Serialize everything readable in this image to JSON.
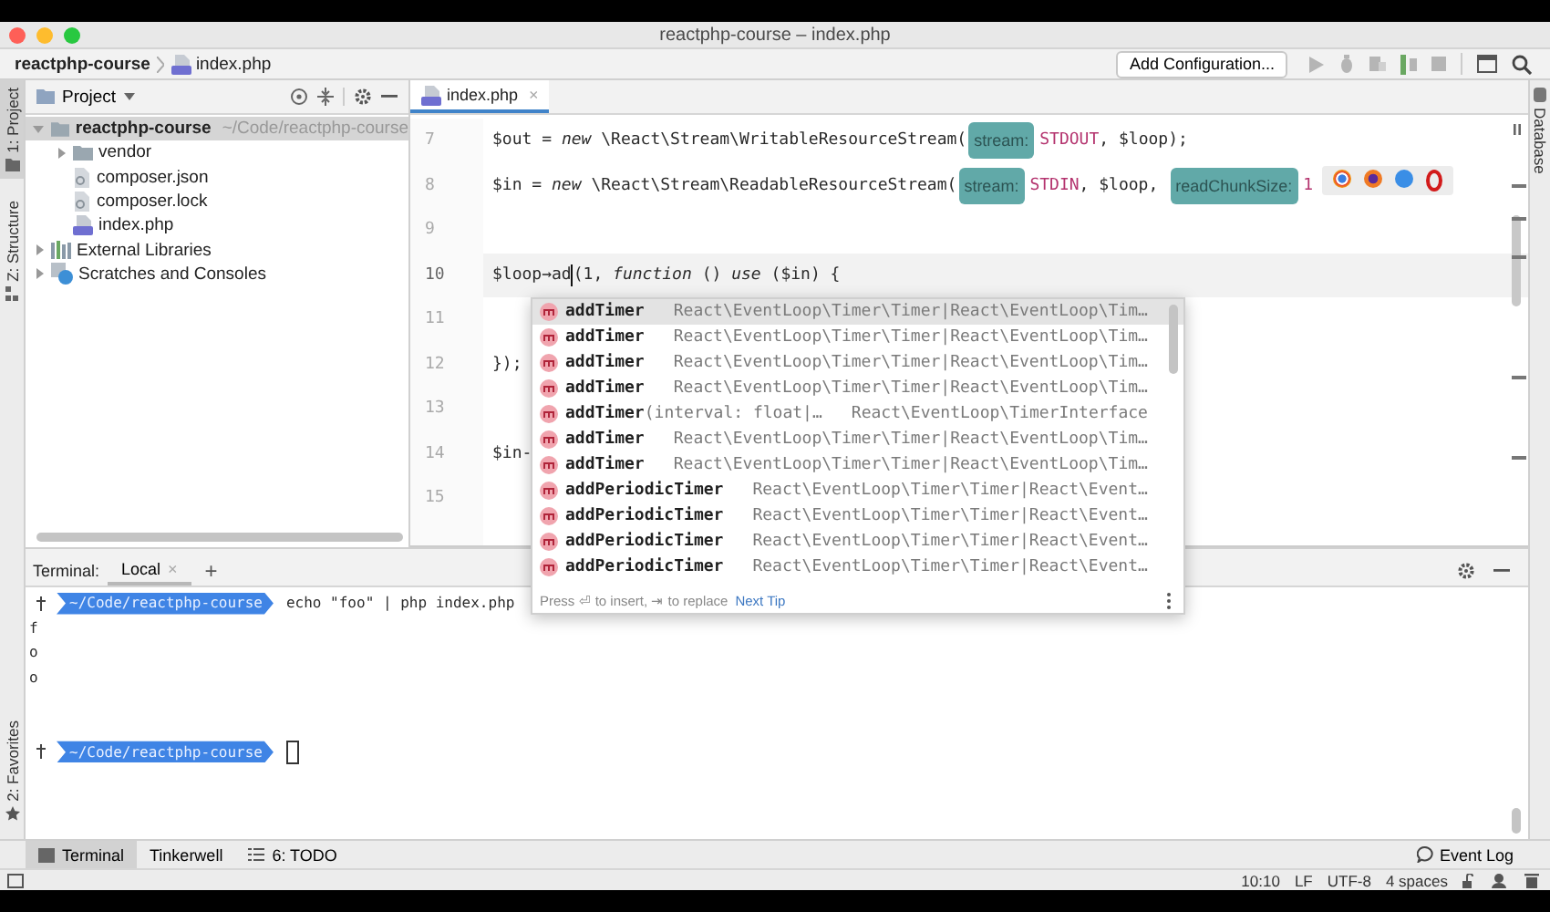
{
  "window": {
    "title": "reactphp-course – index.php"
  },
  "breadcrumbs": [
    {
      "label": "reactphp-course",
      "kind": "project"
    },
    {
      "label": "index.php",
      "kind": "php"
    }
  ],
  "toolbar": {
    "run_configuration": "Add Configuration..."
  },
  "left_stripe": [
    {
      "label": "1: Project",
      "kind": "project",
      "selected": true
    },
    {
      "label": "Z: Structure",
      "kind": "structure",
      "selected": false
    },
    {
      "label": "2: Favorites",
      "kind": "favorites",
      "selected": false
    }
  ],
  "project_panel": {
    "title": "Project",
    "tree": [
      {
        "label": "reactphp-course",
        "path": "~/Code/reactphp-course",
        "kind": "folder",
        "expanded": true,
        "selected": true,
        "children": [
          {
            "label": "vendor",
            "kind": "folder",
            "expanded": false,
            "selected": false
          },
          {
            "label": "composer.json",
            "kind": "config",
            "selected": false
          },
          {
            "label": "composer.lock",
            "kind": "config",
            "selected": false
          },
          {
            "label": "index.php",
            "kind": "php",
            "selected": false
          }
        ]
      },
      {
        "label": "External Libraries",
        "kind": "library",
        "expanded": false,
        "selected": false
      },
      {
        "label": "Scratches and Consoles",
        "kind": "scratches",
        "expanded": false,
        "selected": false
      }
    ]
  },
  "editor": {
    "tabs": [
      {
        "label": "index.php",
        "close": "×",
        "selected": true
      }
    ],
    "lines": [
      {
        "number": "7",
        "current": false,
        "segments": [
          {
            "kind": "plain",
            "text": "$out = "
          },
          {
            "kind": "keyword",
            "text": "new"
          },
          {
            "kind": "plain",
            "text": " \\React\\Stream\\WritableResourceStream("
          },
          {
            "kind": "hint",
            "text": "stream:"
          },
          {
            "kind": "constant",
            "text": "STDOUT"
          },
          {
            "kind": "plain",
            "text": ", $loop);"
          }
        ]
      },
      {
        "number": "8",
        "current": false,
        "segments": [
          {
            "kind": "plain",
            "text": "$in = "
          },
          {
            "kind": "keyword",
            "text": "new"
          },
          {
            "kind": "plain",
            "text": " \\React\\Stream\\ReadableResourceStream("
          },
          {
            "kind": "hint",
            "text": "stream:"
          },
          {
            "kind": "constant",
            "text": "STDIN"
          },
          {
            "kind": "plain",
            "text": ", $loop, "
          },
          {
            "kind": "hint",
            "text": "readChunkSize:"
          },
          {
            "kind": "constant",
            "text": "1"
          }
        ]
      },
      {
        "number": "9",
        "current": false
      },
      {
        "number": "10",
        "current": true,
        "segments": [
          {
            "kind": "plain",
            "text": "$loop→ad"
          },
          {
            "kind": "caret"
          },
          {
            "kind": "plain",
            "text": "(1, "
          },
          {
            "kind": "keyword",
            "text": "function"
          },
          {
            "kind": "plain",
            "text": " () "
          },
          {
            "kind": "keyword",
            "text": "use"
          },
          {
            "kind": "plain",
            "text": " ($in) {"
          }
        ]
      },
      {
        "number": "11",
        "current": false
      },
      {
        "number": "12",
        "current": false,
        "segments": [
          {
            "kind": "plain",
            "text": "});"
          }
        ]
      },
      {
        "number": "13",
        "current": false
      },
      {
        "number": "14",
        "current": false,
        "segments": [
          {
            "kind": "plain",
            "text": "$in-"
          }
        ]
      },
      {
        "number": "15",
        "current": false
      }
    ]
  },
  "completion": {
    "items": [
      {
        "name": "addTimer",
        "type": "React\\EventLoop\\Timer\\Timer|React\\EventLoop\\Tim…",
        "selected": true
      },
      {
        "name": "addTimer",
        "type": "React\\EventLoop\\Timer\\Timer|React\\EventLoop\\Tim…",
        "selected": false
      },
      {
        "name": "addTimer",
        "type": "React\\EventLoop\\Timer\\Timer|React\\EventLoop\\Tim…",
        "selected": false
      },
      {
        "name": "addTimer",
        "type": "React\\EventLoop\\Timer\\Timer|React\\EventLoop\\Tim…",
        "selected": false
      },
      {
        "name": "addTimer",
        "params": "(interval: float|…",
        "type": "React\\EventLoop\\TimerInterface",
        "selected": false
      },
      {
        "name": "addTimer",
        "type": "React\\EventLoop\\Timer\\Timer|React\\EventLoop\\Tim…",
        "selected": false
      },
      {
        "name": "addTimer",
        "type": "React\\EventLoop\\Timer\\Timer|React\\EventLoop\\Tim…",
        "selected": false
      },
      {
        "name": "addPeriodicTimer",
        "type": "React\\EventLoop\\Timer\\Timer|React\\Event…",
        "selected": false
      },
      {
        "name": "addPeriodicTimer",
        "type": "React\\EventLoop\\Timer\\Timer|React\\Event…",
        "selected": false
      },
      {
        "name": "addPeriodicTimer",
        "type": "React\\EventLoop\\Timer\\Timer|React\\Event…",
        "selected": false
      },
      {
        "name": "addPeriodicTimer",
        "type": "React\\EventLoop\\Timer\\Timer|React\\Event…",
        "selected": false
      }
    ],
    "footer": "Press ⏎ to insert, ⇥ to replace",
    "tip_link": "Next Tip"
  },
  "right_stripe": [
    {
      "label": "Database"
    }
  ],
  "terminal": {
    "title": "Terminal:",
    "tabs": [
      {
        "label": "Local",
        "close": "×",
        "selected": true
      }
    ],
    "new_tab": "+",
    "lines": [
      {
        "kind": "prompt",
        "path": "~/Code/reactphp-course",
        "command": "echo \"foo\" | php index.php"
      },
      {
        "kind": "output",
        "text": "f"
      },
      {
        "kind": "output",
        "text": "o"
      },
      {
        "kind": "output",
        "text": "o"
      },
      {
        "kind": "blank"
      },
      {
        "kind": "blank"
      },
      {
        "kind": "prompt",
        "path": "~/Code/reactphp-course",
        "cursor": true
      }
    ]
  },
  "tool_tabs": [
    {
      "label": "Terminal",
      "kind": "terminal",
      "selected": true
    },
    {
      "label": "Tinkerwell",
      "kind": "plain",
      "selected": false
    },
    {
      "label": "6: TODO",
      "kind": "todo",
      "selected": false
    }
  ],
  "event_log": "Event Log",
  "status_bar": {
    "items": [
      "10:10",
      "LF",
      "UTF-8",
      "4 spaces"
    ]
  }
}
